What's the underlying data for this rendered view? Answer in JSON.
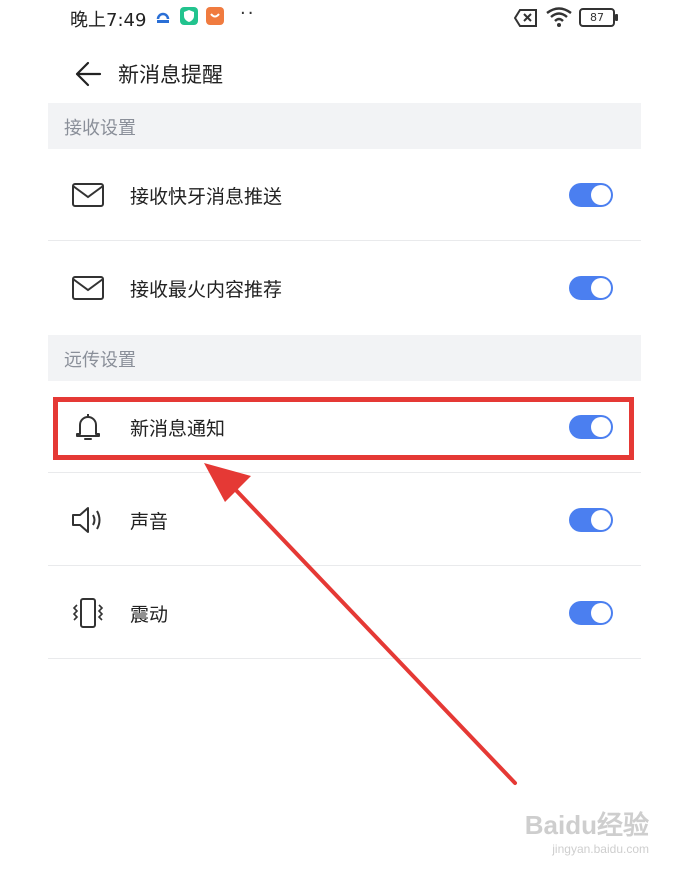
{
  "status_bar": {
    "time": "晚上7:49",
    "battery": "87"
  },
  "header": {
    "title": "新消息提醒"
  },
  "sections": [
    {
      "title": "接收设置",
      "rows": [
        {
          "label": "接收快牙消息推送",
          "icon": "envelope-icon",
          "toggle_on": true
        },
        {
          "label": "接收最火内容推荐",
          "icon": "envelope-icon",
          "toggle_on": true
        }
      ]
    },
    {
      "title": "远传设置",
      "rows": [
        {
          "label": "新消息通知",
          "icon": "bell-icon",
          "toggle_on": true
        },
        {
          "label": "声音",
          "icon": "speaker-icon",
          "toggle_on": true
        },
        {
          "label": "震动",
          "icon": "vibrate-icon",
          "toggle_on": true
        }
      ]
    }
  ],
  "colors": {
    "toggle_on": "#4b7ff0",
    "annotation": "#e53935",
    "section_bg": "#f2f3f5"
  },
  "watermark": {
    "main": "Baidu经验",
    "sub": "jingyan.baidu.com"
  }
}
